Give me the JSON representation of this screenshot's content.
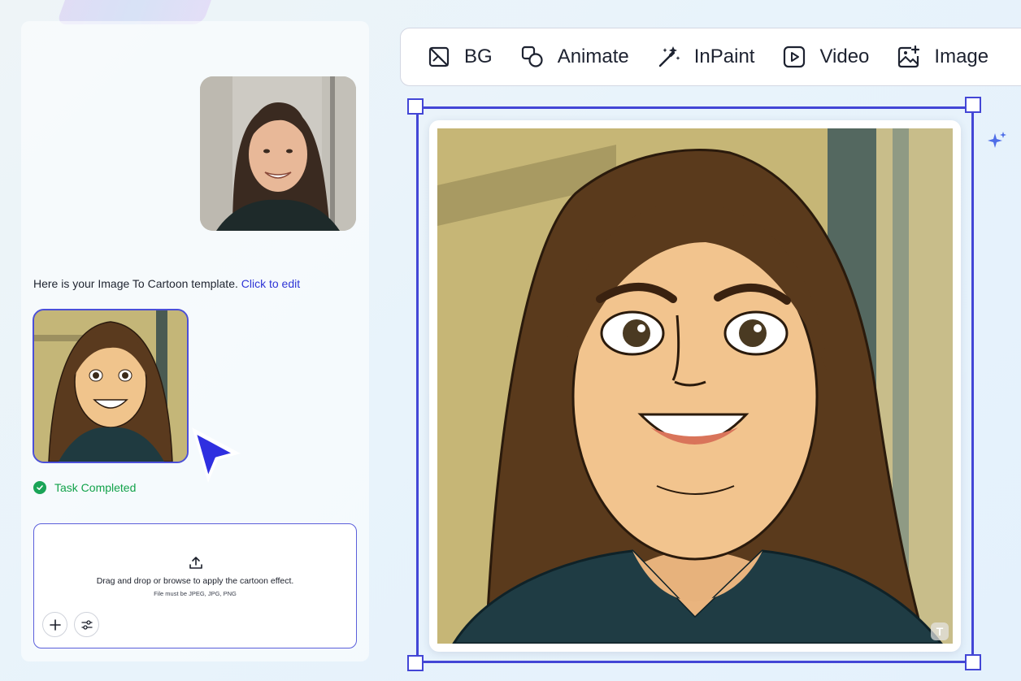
{
  "toolbar": {
    "items": [
      {
        "label": "BG",
        "icon": "bg-remove-icon"
      },
      {
        "label": "Animate",
        "icon": "animate-icon"
      },
      {
        "label": "InPaint",
        "icon": "magic-wand-icon"
      },
      {
        "label": "Video",
        "icon": "video-play-icon"
      },
      {
        "label": "Image",
        "icon": "image-add-icon"
      }
    ]
  },
  "chat": {
    "template_message": "Here is your Image To Cartoon template.",
    "edit_link": "Click to edit",
    "status": "Task Completed"
  },
  "upload": {
    "main_text": "Drag and drop or browse to apply the cartoon effect.",
    "sub_text": "File must be JPEG, JPG, PNG"
  },
  "watermark": {
    "label": "T"
  },
  "colors": {
    "accent": "#4346d6",
    "link": "#2f35d6",
    "success": "#12a24a",
    "text": "#1d2230"
  }
}
